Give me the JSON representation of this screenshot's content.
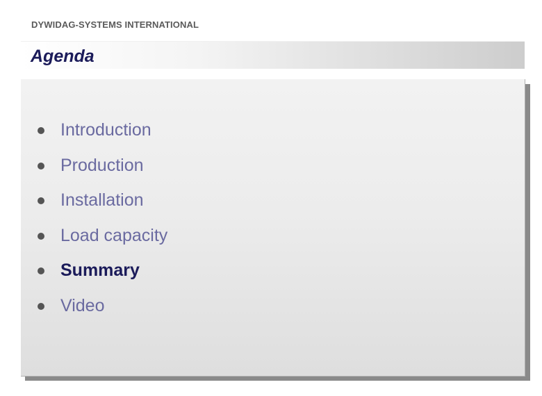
{
  "header": {
    "company": "DYWIDAG-SYSTEMS INTERNATIONAL"
  },
  "slide": {
    "title": "Agenda"
  },
  "agenda": {
    "items": [
      {
        "label": "Introduction",
        "active": false
      },
      {
        "label": "Production",
        "active": false
      },
      {
        "label": "Installation",
        "active": false
      },
      {
        "label": "Load capacity",
        "active": false
      },
      {
        "label": "Summary",
        "active": true
      },
      {
        "label": "Video",
        "active": false
      }
    ]
  },
  "colors": {
    "title": "#1b1b5a",
    "item_inactive": "#6a6aa0",
    "item_active": "#1b1b5a",
    "bullet": "#555555",
    "company": "#5a5a5a"
  }
}
